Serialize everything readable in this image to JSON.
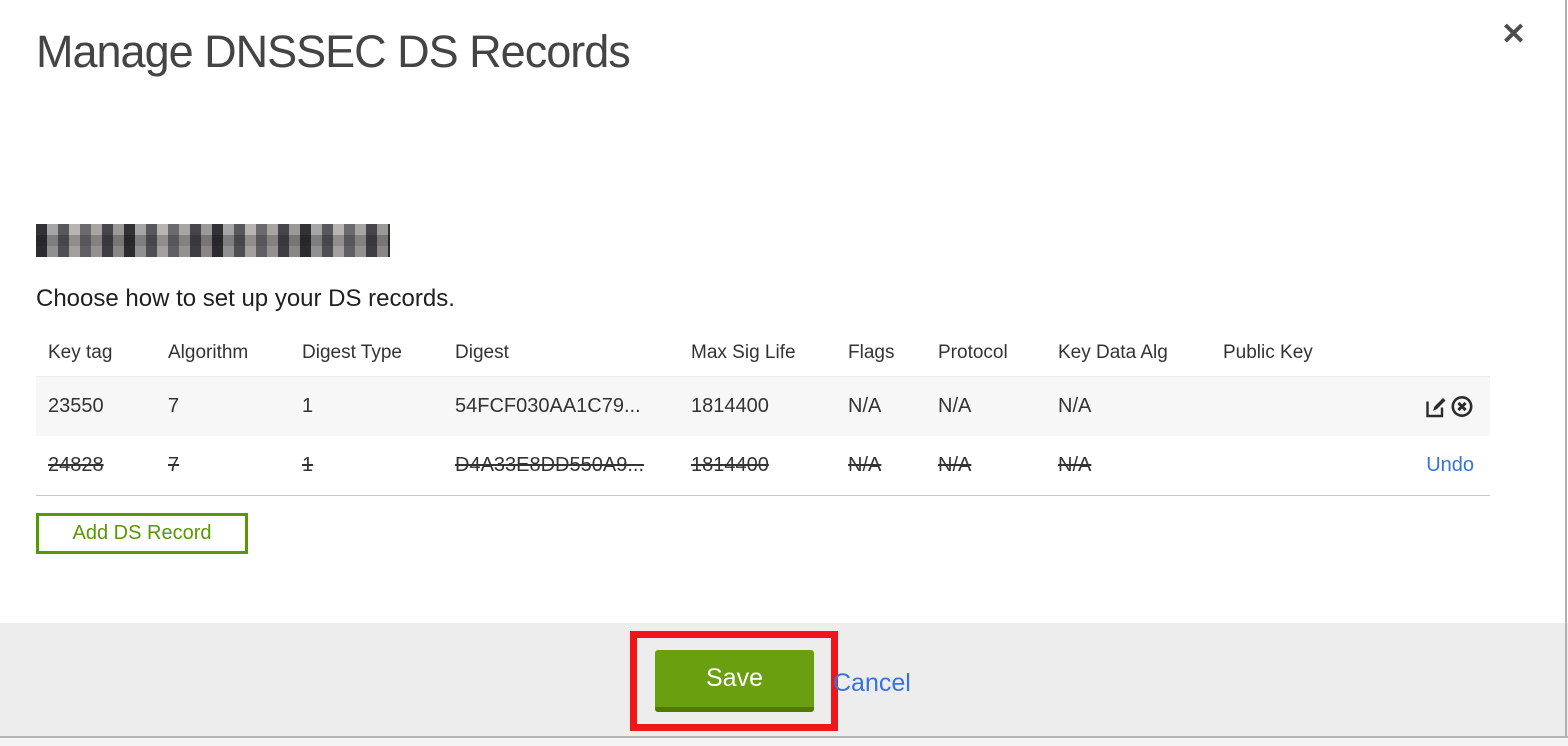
{
  "modal": {
    "title": "Manage DNSSEC DS Records",
    "close_label": "✕",
    "instruction": "Choose how to set up your DS records."
  },
  "table": {
    "columns": [
      "Key tag",
      "Algorithm",
      "Digest Type",
      "Digest",
      "Max Sig Life",
      "Flags",
      "Protocol",
      "Key Data Alg",
      "Public Key"
    ],
    "rows": [
      {
        "key_tag": "23550",
        "algorithm": "7",
        "digest_type": "1",
        "digest": "54FCF030AA1C79...",
        "max_sig_life": "1814400",
        "flags": "N/A",
        "protocol": "N/A",
        "key_data_alg": "N/A",
        "public_key": "",
        "state": "normal",
        "actions": [
          "edit-icon",
          "delete-icon"
        ]
      },
      {
        "key_tag": "24828",
        "algorithm": "7",
        "digest_type": "1",
        "digest": "D4A33E8DD550A9...",
        "max_sig_life": "1814400",
        "flags": "N/A",
        "protocol": "N/A",
        "key_data_alg": "N/A",
        "public_key": "",
        "state": "deleted",
        "undo_label": "Undo"
      }
    ]
  },
  "buttons": {
    "add_ds_record": "Add DS Record",
    "save": "Save",
    "cancel": "Cancel"
  },
  "colors": {
    "button_green": "#6aa00f",
    "button_green_dark": "#4f7a06",
    "outline_green": "#5a9700",
    "link_blue": "#3673e0",
    "annotation_red": "#ee1618",
    "row_alt_bg": "#f7f7f7",
    "footer_bg": "#ededed"
  }
}
